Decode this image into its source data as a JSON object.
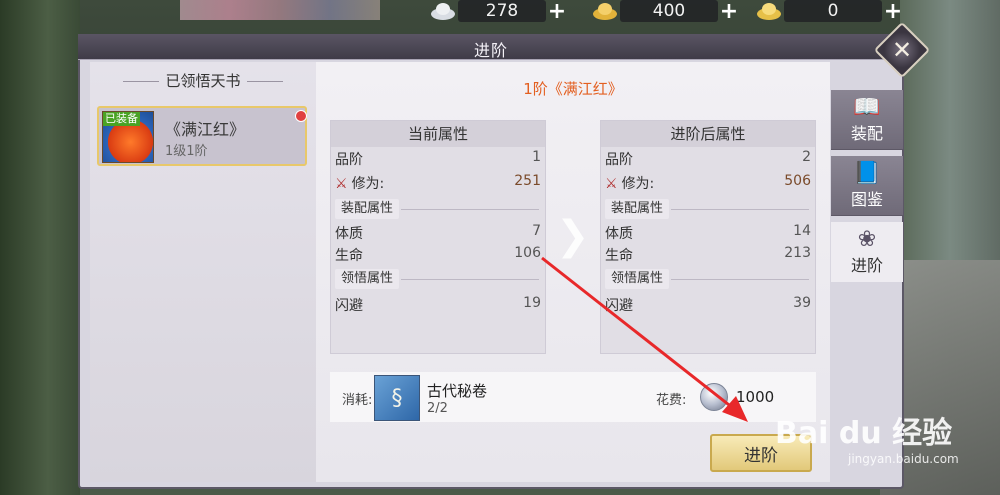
{
  "currencies": [
    {
      "icon": "silver-ingot-icon",
      "value": "278"
    },
    {
      "icon": "gold-ingot-icon",
      "value": "400"
    },
    {
      "icon": "bound-gold-icon",
      "value": "0"
    }
  ],
  "window": {
    "title": "进阶",
    "close_glyph": "✕"
  },
  "left": {
    "title": "已领悟天书",
    "items": [
      {
        "tag": "已装备",
        "name": "《满江红》",
        "level": "1级1阶"
      }
    ]
  },
  "main": {
    "title": "1阶《满江红》",
    "current": {
      "header": "当前属性",
      "grade_label": "品阶",
      "grade": "1",
      "cultivation_label": "修为:",
      "cultivation": "251",
      "equip_header": "装配属性",
      "con_label": "体质",
      "con": "7",
      "hp_label": "生命",
      "hp": "106",
      "comp_header": "领悟属性",
      "dodge_label": "闪避",
      "dodge": "19"
    },
    "next": {
      "header": "进阶后属性",
      "grade_label": "品阶",
      "grade": "2",
      "cultivation_label": "修为:",
      "cultivation": "506",
      "equip_header": "装配属性",
      "con_label": "体质",
      "con": "14",
      "hp_label": "生命",
      "hp": "213",
      "comp_header": "领悟属性",
      "dodge_label": "闪避",
      "dodge": "39"
    },
    "consume": {
      "label": "消耗:",
      "item_name": "古代秘卷",
      "item_count": "2/2",
      "cost_label": "花费:",
      "cost_value": "1000"
    },
    "advance_button": "进阶"
  },
  "tabs": [
    {
      "label": "装配",
      "icon": "book-icon",
      "active": false
    },
    {
      "label": "图鉴",
      "icon": "catalog-icon",
      "active": false
    },
    {
      "label": "进阶",
      "icon": "lotus-icon",
      "active": true
    }
  ],
  "watermark": {
    "main": "Bai du 经验",
    "sub": "jingyan.baidu.com"
  },
  "colors": {
    "accent": "#e35f20",
    "annotation_arrow": "#e8282a"
  }
}
